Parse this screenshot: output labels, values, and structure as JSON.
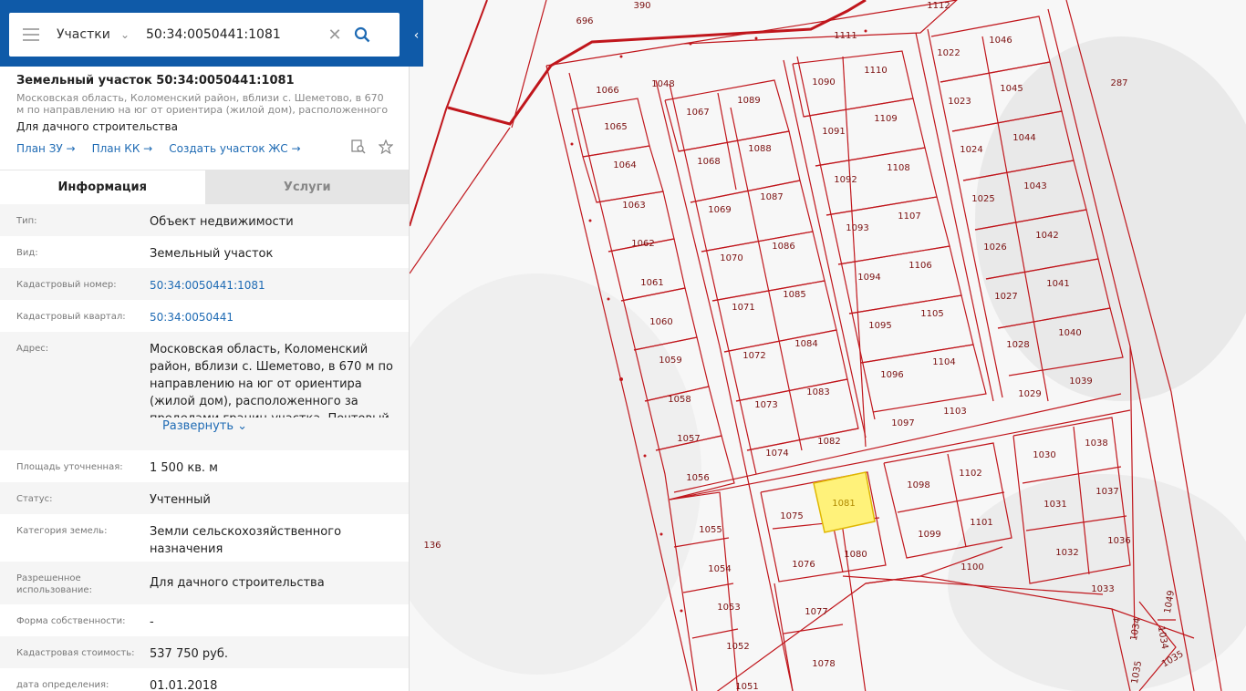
{
  "search": {
    "type_label": "Участки",
    "value": "50:34:0050441:1081"
  },
  "object": {
    "title": "Земельный участок 50:34:0050441:1081",
    "address_short": "Московская область, Коломенский район, вблизи с. Шеметово, в 670 м по направлению на юг от ориентира (жилой дом), расположенного за пределам...",
    "purpose": "Для дачного строительства",
    "links": [
      "План ЗУ →",
      "План КК →",
      "Создать участок ЖС →"
    ]
  },
  "tabs": [
    "Информация",
    "Услуги"
  ],
  "info": {
    "type_k": "Тип:",
    "type_v": "Объект недвижимости",
    "kind_k": "Вид:",
    "kind_v": "Земельный участок",
    "cad_k": "Кадастровый номер:",
    "cad_v": "50:34:0050441:1081",
    "quarter_k": "Кадастровый квартал:",
    "quarter_v": "50:34:0050441",
    "addr_k": "Адрес:",
    "addr_v": "Московская область, Коломенский район, вблизи с. Шеметово, в 670 м по направлению на юг от ориентира (жилой дом), расположенного за пределами границ участка. Почтовый",
    "expand": "Развернуть",
    "area_k": "Площадь уточненная:",
    "area_v": "1 500 кв. м",
    "status_k": "Статус:",
    "status_v": "Учтенный",
    "cat_k": "Категория земель:",
    "cat_v": "Земли сельскохозяйственного назначения",
    "use_k": "Разрешенное использование:",
    "use_v": "Для дачного строительства",
    "own_k": "Форма собственности:",
    "own_v": "-",
    "cost_k": "Кадастровая стоимость:",
    "cost_v": "537 750 руб.",
    "date_k": "дата определения:",
    "date_v": "01.01.2018"
  },
  "map": {
    "parcel_labels": [
      "696",
      "390",
      "1112",
      "1111",
      "1022",
      "1046",
      "1066",
      "1048",
      "1089",
      "1090",
      "1110",
      "287",
      "1065",
      "1067",
      "1088",
      "1091",
      "1109",
      "1023",
      "1045",
      "1064",
      "1068",
      "1087",
      "1092",
      "1108",
      "1024",
      "1044",
      "1063",
      "1069",
      "1086",
      "1093",
      "1107",
      "1025",
      "1043",
      "1062",
      "1070",
      "1085",
      "1094",
      "1106",
      "1026",
      "1042",
      "1061",
      "1071",
      "1084",
      "1095",
      "1105",
      "1027",
      "1041",
      "1060",
      "1072",
      "1083",
      "1096",
      "1104",
      "1028",
      "1040",
      "1059",
      "1073",
      "1082",
      "1097",
      "1103",
      "1029",
      "1039",
      "1058",
      "1074",
      "1098",
      "1102",
      "1030",
      "1038",
      "1057",
      "1075",
      "1081",
      "1099",
      "1101",
      "1031",
      "1037",
      "1056",
      "1076",
      "1080",
      "1100",
      "1032",
      "1036",
      "1055",
      "1077",
      "1033",
      "1049",
      "1054",
      "1078",
      "1034",
      "1035",
      "1053",
      "1051",
      "1052",
      "136"
    ],
    "selected": "1081",
    "colors": {
      "boundary": "#c0161c",
      "selected_fill": "#fff27a",
      "label": "#7a1010"
    }
  }
}
